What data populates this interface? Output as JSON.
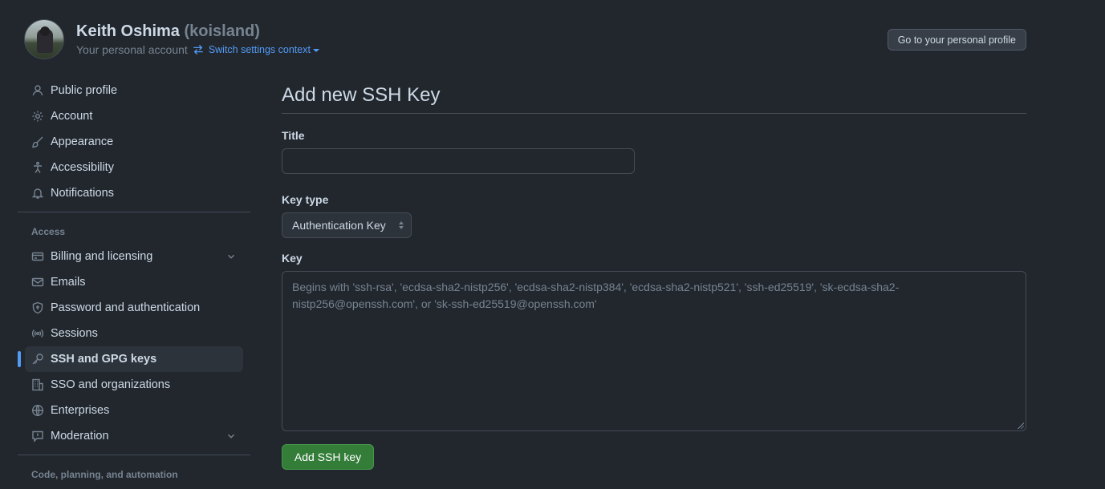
{
  "header": {
    "name": "Keith Oshima",
    "handle": "(koisland)",
    "subtitle": "Your personal account",
    "switch_context": "Switch settings context",
    "profile_button": "Go to your personal profile"
  },
  "sidebar": {
    "items": [
      {
        "label": "Public profile",
        "icon": "person-icon"
      },
      {
        "label": "Account",
        "icon": "gear-icon"
      },
      {
        "label": "Appearance",
        "icon": "paintbrush-icon"
      },
      {
        "label": "Accessibility",
        "icon": "accessibility-icon"
      },
      {
        "label": "Notifications",
        "icon": "bell-icon"
      }
    ],
    "access_label": "Access",
    "access_items": [
      {
        "label": "Billing and licensing",
        "icon": "credit-card-icon"
      },
      {
        "label": "Emails",
        "icon": "mail-icon"
      },
      {
        "label": "Password and authentication",
        "icon": "shield-lock-icon"
      },
      {
        "label": "Sessions",
        "icon": "broadcast-icon"
      },
      {
        "label": "SSH and GPG keys",
        "icon": "key-icon"
      },
      {
        "label": "SSO and organizations",
        "icon": "organization-icon"
      },
      {
        "label": "Enterprises",
        "icon": "globe-icon"
      },
      {
        "label": "Moderation",
        "icon": "report-icon"
      }
    ],
    "code_label": "Code, planning, and automation",
    "active": "SSH and GPG keys"
  },
  "main": {
    "title": "Add new SSH Key",
    "title_label": "Title",
    "title_value": "",
    "key_type_label": "Key type",
    "key_type_value": "Authentication Key",
    "key_label": "Key",
    "key_placeholder": "Begins with 'ssh-rsa', 'ecdsa-sha2-nistp256', 'ecdsa-sha2-nistp384', 'ecdsa-sha2-nistp521', 'ssh-ed25519', 'sk-ecdsa-sha2-nistp256@openssh.com', or 'sk-ssh-ed25519@openssh.com'",
    "submit_label": "Add SSH key"
  },
  "colors": {
    "background": "#22272e",
    "accent": "#539bf5",
    "primary_button": "#347d39"
  }
}
